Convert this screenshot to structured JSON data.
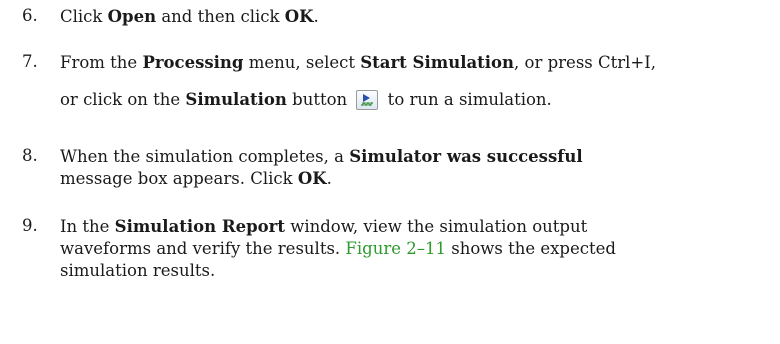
{
  "steps": [
    {
      "number": "6.",
      "t1": "Click ",
      "b1": "Open",
      "t2": " and then click ",
      "b2": "OK",
      "t3": "."
    },
    {
      "number": "7.",
      "t1": "From the ",
      "b1": "Processing",
      "t2": " menu, select ",
      "b2": "Start Simulation",
      "t3": ", or press Ctrl+I,",
      "t4": "or click on the ",
      "b3": "Simulation",
      "t5": " button",
      "t6": " to run a simulation.",
      "button_icon": "simulation-run-icon"
    },
    {
      "number": "8.",
      "t1": "When the simulation completes, a ",
      "b1": "Simulator was successful",
      "t2": "message box appears. Click ",
      "b2": "OK",
      "t3": "."
    },
    {
      "number": "9.",
      "t1": "In the ",
      "b1": "Simulation Report",
      "t2": " window, view the simulation output",
      "t3": "waveforms and verify the results. ",
      "link": "Figure 2–11",
      "t4": " shows the expected",
      "t5": "simulation results."
    }
  ],
  "colors": {
    "link": "#2e9a2e",
    "text": "#1a1a1a"
  }
}
